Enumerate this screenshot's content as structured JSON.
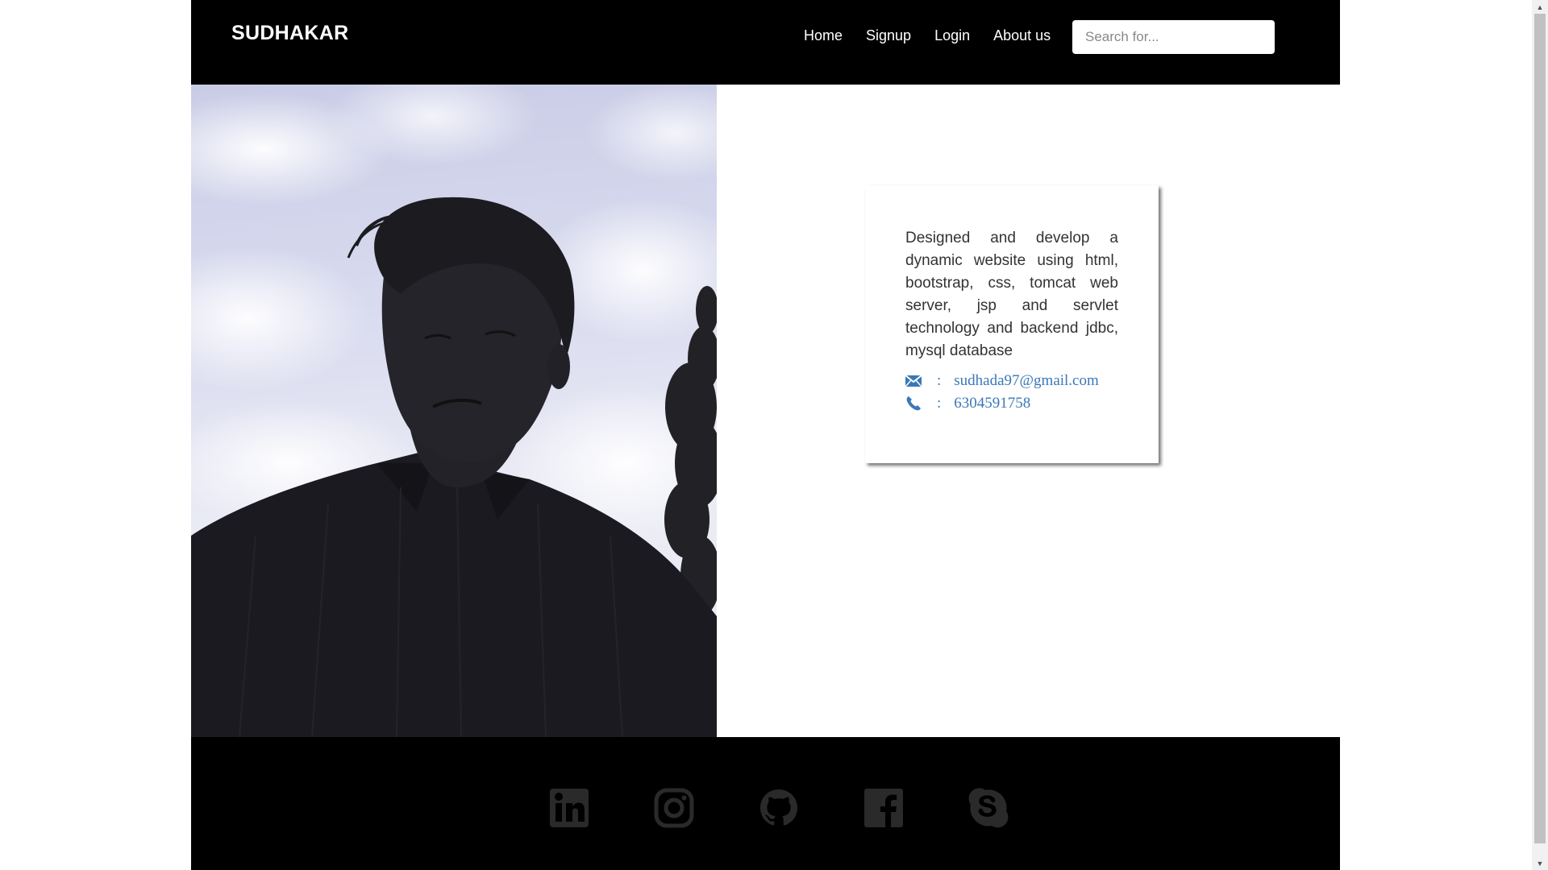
{
  "navbar": {
    "brand": "SUDHAKAR",
    "links": [
      "Home",
      "Signup",
      "Login",
      "About us"
    ],
    "search_placeholder": "Search for..."
  },
  "profile": {
    "description": "Designed and develop a dynamic website using html, bootstrap, css, tomcat web server, jsp and servlet technology and backend jdbc, mysql database",
    "email": "sudhada97@gmail.com",
    "phone": "6304591758",
    "separator": ":",
    "email_icon": "envelope-icon",
    "phone_icon": "phone-icon"
  },
  "footer": {
    "socials": [
      "linkedin-icon",
      "instagram-icon",
      "github-icon",
      "facebook-icon",
      "skype-icon"
    ]
  },
  "colors": {
    "navbar_bg": "#000000",
    "footer_bg": "#000000",
    "link_blue": "#3a78b8",
    "social_icon": "#2a2a2a"
  }
}
